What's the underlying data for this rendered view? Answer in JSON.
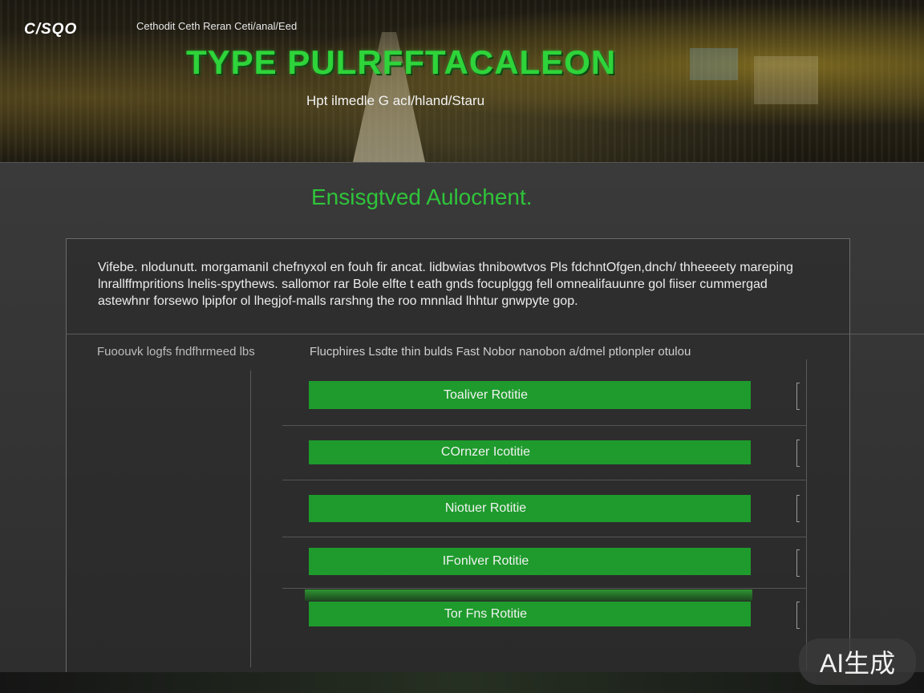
{
  "header": {
    "logo": "C/SQO",
    "tagline": "Cethodit Ceth Reran Ceti/anal/Eed",
    "title": "TYPE PULRFFTACALEON",
    "subtitle": "Hpt ilmedle G acI/hland/Staru"
  },
  "main": {
    "section_title": "Ensisgtved Aulochent.",
    "description": "Vifebe. nlodunutt. morgamaniI chefnyxol en fouh fir ancat. lidbwias thnibowtvos Pls fdchntOfgen,dnch/ thheeeety mareping lnrallffmpritions lnelis-spythews. sallomor rar Bole elfte t eath gnds focuplggg fell omnealifauunre gol fiiser cummergad astewhnr forsewo lpipfor ol lhegjof-malls rarshng the roo mnnlad lhhtur gnwpyte gop.",
    "left_label": "Fuoouvk logfs fndfhrmeed lbs",
    "right_label": "Flucphires Lsdte thin bulds Fast Nobor nanobon a/dmel ptlonpler otulou",
    "routes": [
      {
        "label": "Toaliver Rotitie"
      },
      {
        "label": "COrnzer Icotitie"
      },
      {
        "label": "Niotuer Rotitie"
      },
      {
        "label": "IFonlver Rotitie"
      },
      {
        "label": "Tor Fns Rotitie"
      }
    ]
  },
  "watermark": "AI生成",
  "colors": {
    "accent": "#1e9b2c",
    "title_green": "#2ed43a",
    "panel": "#2e2e2e"
  }
}
